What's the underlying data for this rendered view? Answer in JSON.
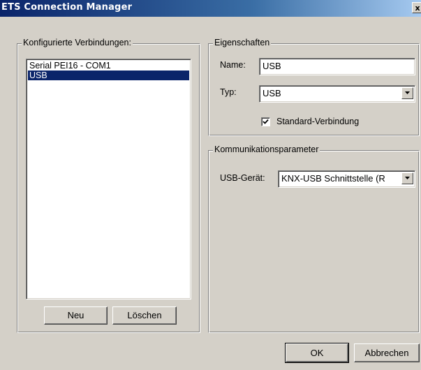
{
  "window": {
    "title": "ETS Connection Manager",
    "close_glyph": "x"
  },
  "configured": {
    "legend": "Konfigurierte Verbindungen:",
    "items": [
      {
        "label": "Serial PEI16 - COM1",
        "selected": false
      },
      {
        "label": "USB",
        "selected": true
      }
    ],
    "new_label": "Neu",
    "delete_label": "Löschen"
  },
  "properties": {
    "legend": "Eigenschaften",
    "name_label": "Name:",
    "name_value": "USB",
    "type_label": "Typ:",
    "type_value": "USB",
    "default_label": "Standard-Verbindung",
    "default_checked": true
  },
  "communication": {
    "legend": "Kommunikationsparameter",
    "device_label": "USB-Gerät:",
    "device_value": "KNX-USB Schnittstelle (R"
  },
  "footer": {
    "ok_label": "OK",
    "cancel_label": "Abbrechen"
  },
  "colors": {
    "face": "#d4d0c8",
    "selection": "#0a246a",
    "title_start": "#0a246a",
    "title_end": "#a6caf0"
  }
}
